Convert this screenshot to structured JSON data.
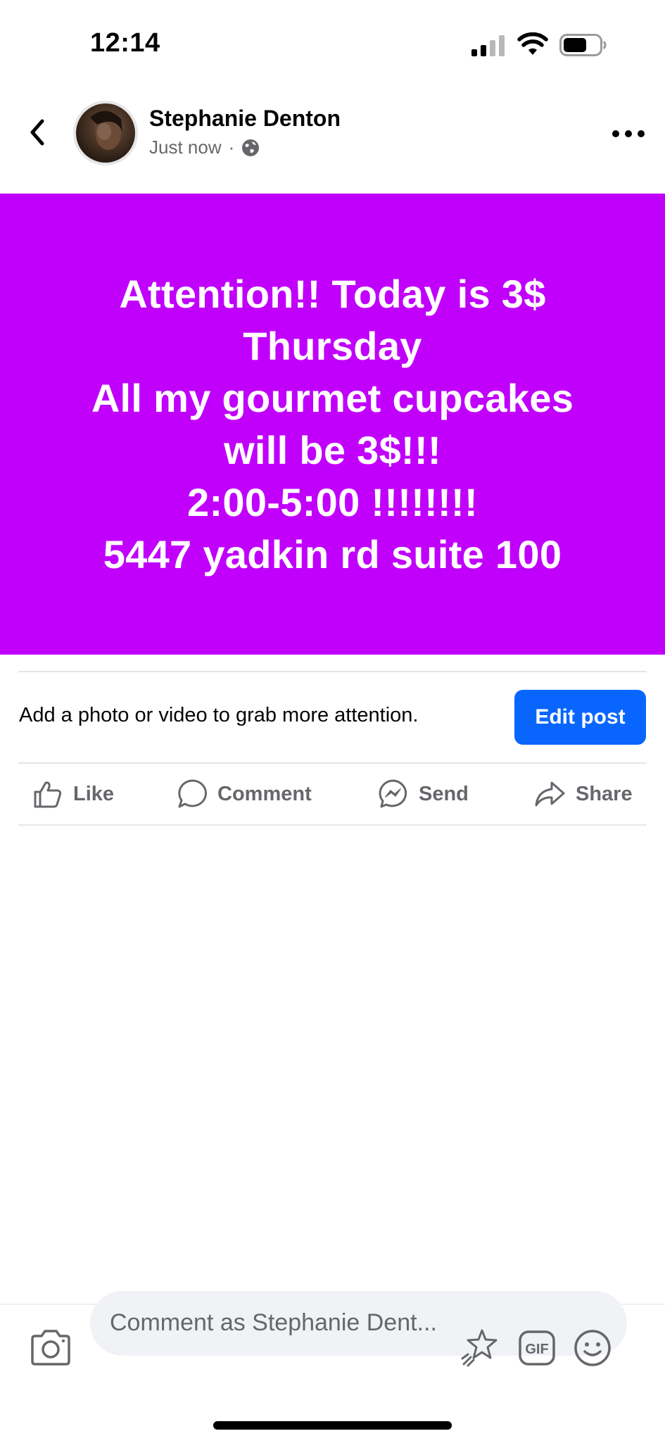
{
  "status_bar": {
    "time": "12:14"
  },
  "post": {
    "author_name": "Stephanie Denton",
    "timestamp": "Just now",
    "meta_separator": "·",
    "banner_color": "#c000fb",
    "banner_text": "Attention!! Today is 3$\nThursday\nAll my gourmet cupcakes\nwill be 3$!!!\n2:00-5:00 !!!!!!!!\n5447 yadkin rd suite 100"
  },
  "nudge": {
    "text": "Add a photo or video to grab more attention.",
    "button_label": "Edit post",
    "button_color": "#0866ff"
  },
  "actions": [
    {
      "label": "Like",
      "icon": "thumbs-up-icon"
    },
    {
      "label": "Comment",
      "icon": "comment-bubble-icon"
    },
    {
      "label": "Send",
      "icon": "messenger-icon"
    },
    {
      "label": "Share",
      "icon": "share-arrow-icon"
    }
  ],
  "comment_bar": {
    "placeholder": "Comment as Stephanie Dent...",
    "icons": [
      "camera-icon",
      "sticker-icon",
      "gif-icon",
      "emoji-icon"
    ]
  }
}
